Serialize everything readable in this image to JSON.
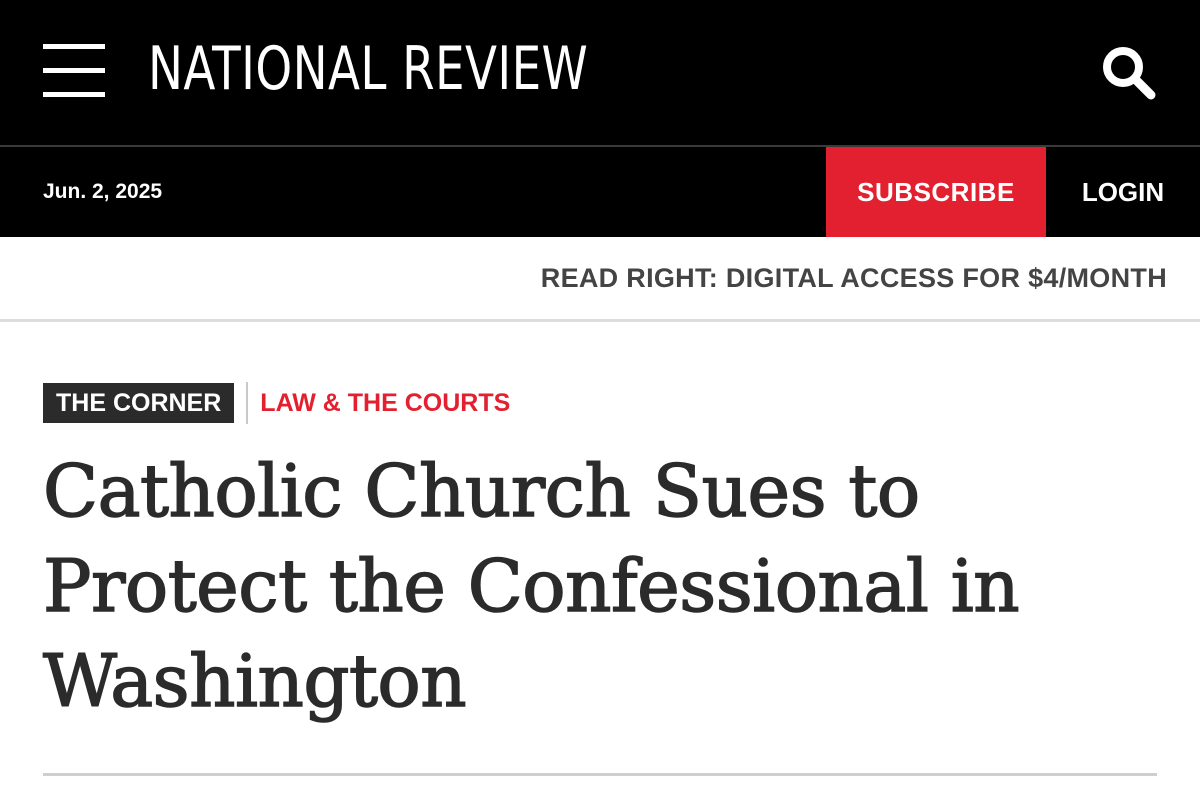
{
  "header": {
    "logo_text": "NATIONAL REVIEW",
    "menu_icon": "hamburger-menu-icon",
    "search_icon": "search-icon",
    "background": "#000000"
  },
  "subbar": {
    "date": "Jun. 2, 2025",
    "subscribe_label": "SUBSCRIBE",
    "login_label": "LOGIN",
    "subscribe_color": "#e3202f"
  },
  "promo": {
    "text": "READ RIGHT: DIGITAL ACCESS FOR $4/MONTH"
  },
  "article": {
    "section": "THE CORNER",
    "topic": "LAW & THE COURTS",
    "headline": "Catholic Church Sues to Protect the Confessional in Washington"
  }
}
